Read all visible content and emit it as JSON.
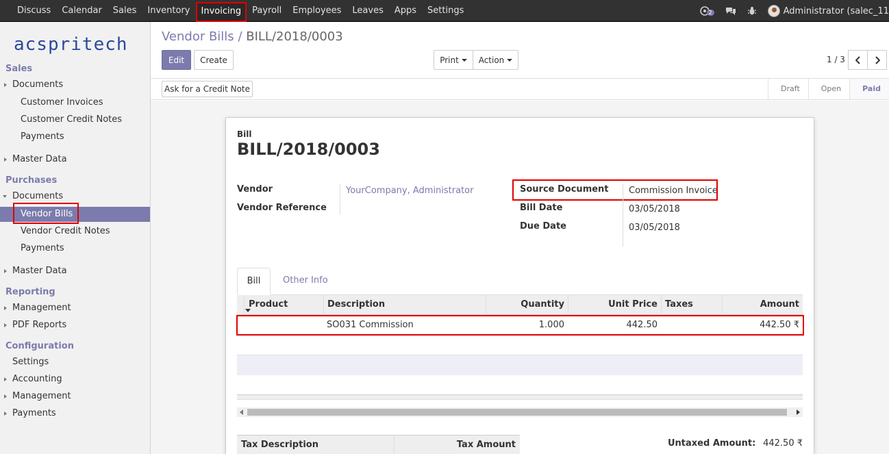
{
  "topnav": {
    "items": [
      "Discuss",
      "Calendar",
      "Sales",
      "Inventory",
      "Invoicing",
      "Payroll",
      "Employees",
      "Leaves",
      "Apps",
      "Settings"
    ],
    "active": "Invoicing",
    "chat_badge": "2",
    "user": "Administrator (salec_11"
  },
  "sidebar": {
    "logo": "acspritech",
    "sales": {
      "title": "Sales",
      "documents": "Documents",
      "customer_invoices": "Customer Invoices",
      "customer_credit_notes": "Customer Credit Notes",
      "payments": "Payments",
      "master_data": "Master Data"
    },
    "purchases": {
      "title": "Purchases",
      "documents": "Documents",
      "vendor_bills": "Vendor Bills",
      "vendor_credit_notes": "Vendor Credit Notes",
      "payments": "Payments",
      "master_data": "Master Data"
    },
    "reporting": {
      "title": "Reporting",
      "management": "Management",
      "pdf_reports": "PDF Reports"
    },
    "configuration": {
      "title": "Configuration",
      "settings": "Settings",
      "accounting": "Accounting",
      "management": "Management",
      "payments": "Payments"
    }
  },
  "breadcrumb": {
    "parent": "Vendor Bills",
    "separator": "/",
    "current": "BILL/2018/0003"
  },
  "buttons": {
    "edit": "Edit",
    "create": "Create",
    "print": "Print",
    "action": "Action",
    "ask_credit_note": "Ask for a Credit Note"
  },
  "pager": {
    "value": "1 / 3"
  },
  "status": {
    "stages": [
      "Draft",
      "Open",
      "Paid"
    ],
    "current": "Paid"
  },
  "form": {
    "type_label": "Bill",
    "number": "BILL/2018/0003",
    "vendor_label": "Vendor",
    "vendor_value": "YourCompany, Administrator",
    "vendor_ref_label": "Vendor Reference",
    "source_doc_label": "Source Document",
    "source_doc_value": "Commission Invoice",
    "bill_date_label": "Bill Date",
    "bill_date_value": "03/05/2018",
    "due_date_label": "Due Date",
    "due_date_value": "03/05/2018"
  },
  "tabs": [
    "Bill",
    "Other Info"
  ],
  "lines_table": {
    "columns": [
      "Product",
      "Description",
      "Quantity",
      "Unit Price",
      "Taxes",
      "Amount"
    ],
    "rows": [
      {
        "product": "",
        "description": "SO031 Commission",
        "quantity": "1.000",
        "unit_price": "442.50",
        "taxes": "",
        "amount": "442.50 ₹"
      }
    ]
  },
  "tax_table": {
    "columns": [
      "Tax Description",
      "Tax Amount"
    ]
  },
  "totals": {
    "untaxed_label": "Untaxed Amount:",
    "untaxed_value": "442.50 ₹"
  },
  "colors": {
    "accent": "#7c7bad",
    "navbar": "#323232",
    "highlight": "#e00000"
  }
}
